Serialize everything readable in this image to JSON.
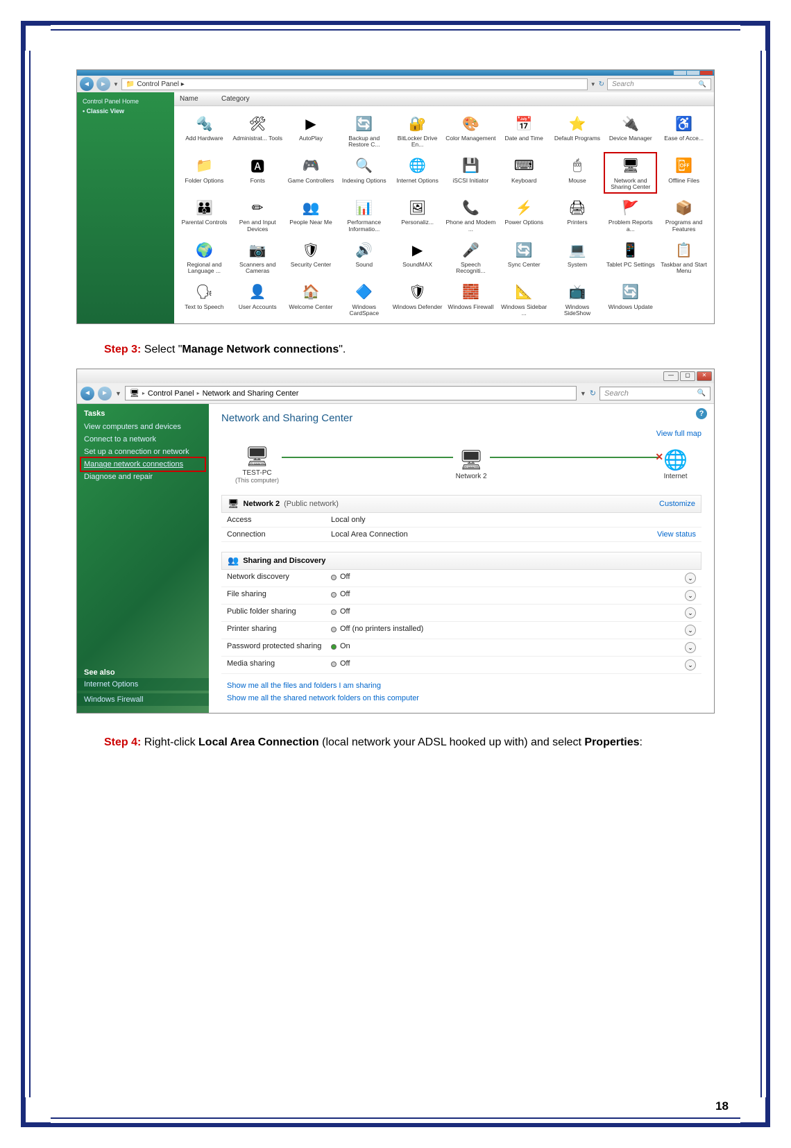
{
  "page_number": "18",
  "step3": {
    "label": "Step 3:",
    "text_before": " Select \"",
    "bold": "Manage Network connections",
    "text_after": "\"."
  },
  "step4": {
    "label": "Step 4:",
    "text_before": " Right-click ",
    "bold1": "Local Area Connection",
    "text_mid": " (local network your ADSL hooked up with) and select ",
    "bold2": "Properties",
    "text_after": ":"
  },
  "scr1": {
    "breadcrumb": "Control Panel  ▸",
    "search_placeholder": "Search",
    "col_name": "Name",
    "col_category": "Category",
    "sidebar": {
      "home": "Control Panel Home",
      "classic": "Classic View"
    },
    "items": [
      {
        "icon": "🔩",
        "label": "Add Hardware"
      },
      {
        "icon": "🛠",
        "label": "Administrat... Tools"
      },
      {
        "icon": "▶",
        "label": "AutoPlay"
      },
      {
        "icon": "🔄",
        "label": "Backup and Restore C..."
      },
      {
        "icon": "🔐",
        "label": "BitLocker Drive En..."
      },
      {
        "icon": "🎨",
        "label": "Color Management"
      },
      {
        "icon": "📅",
        "label": "Date and Time"
      },
      {
        "icon": "⭐",
        "label": "Default Programs"
      },
      {
        "icon": "🔌",
        "label": "Device Manager"
      },
      {
        "icon": "♿",
        "label": "Ease of Acce..."
      },
      {
        "icon": "📁",
        "label": "Folder Options"
      },
      {
        "icon": "🅰",
        "label": "Fonts"
      },
      {
        "icon": "🎮",
        "label": "Game Controllers"
      },
      {
        "icon": "🔍",
        "label": "Indexing Options"
      },
      {
        "icon": "🌐",
        "label": "Internet Options"
      },
      {
        "icon": "💾",
        "label": "iSCSI Initiator"
      },
      {
        "icon": "⌨",
        "label": "Keyboard"
      },
      {
        "icon": "🖱",
        "label": "Mouse"
      },
      {
        "icon": "🖥",
        "label": "Network and Sharing Center",
        "highlighted": true
      },
      {
        "icon": "📴",
        "label": "Offline Files"
      },
      {
        "icon": "👪",
        "label": "Parental Controls"
      },
      {
        "icon": "✏",
        "label": "Pen and Input Devices"
      },
      {
        "icon": "👥",
        "label": "People Near Me"
      },
      {
        "icon": "📊",
        "label": "Performance Informatio..."
      },
      {
        "icon": "🖼",
        "label": "Personaliz..."
      },
      {
        "icon": "📞",
        "label": "Phone and Modem ..."
      },
      {
        "icon": "⚡",
        "label": "Power Options"
      },
      {
        "icon": "🖨",
        "label": "Printers"
      },
      {
        "icon": "🚩",
        "label": "Problem Reports a..."
      },
      {
        "icon": "📦",
        "label": "Programs and Features"
      },
      {
        "icon": "🌍",
        "label": "Regional and Language ..."
      },
      {
        "icon": "📷",
        "label": "Scanners and Cameras"
      },
      {
        "icon": "🛡",
        "label": "Security Center"
      },
      {
        "icon": "🔊",
        "label": "Sound"
      },
      {
        "icon": "▶",
        "label": "SoundMAX"
      },
      {
        "icon": "🎤",
        "label": "Speech Recogniti..."
      },
      {
        "icon": "🔄",
        "label": "Sync Center"
      },
      {
        "icon": "💻",
        "label": "System"
      },
      {
        "icon": "📱",
        "label": "Tablet PC Settings"
      },
      {
        "icon": "📋",
        "label": "Taskbar and Start Menu"
      },
      {
        "icon": "🗣",
        "label": "Text to Speech"
      },
      {
        "icon": "👤",
        "label": "User Accounts"
      },
      {
        "icon": "🏠",
        "label": "Welcome Center"
      },
      {
        "icon": "🔷",
        "label": "Windows CardSpace"
      },
      {
        "icon": "🛡",
        "label": "Windows Defender"
      },
      {
        "icon": "🧱",
        "label": "Windows Firewall"
      },
      {
        "icon": "📐",
        "label": "Windows Sidebar ..."
      },
      {
        "icon": "📺",
        "label": "Windows SideShow"
      },
      {
        "icon": "🔄",
        "label": "Windows Update"
      }
    ]
  },
  "scr2": {
    "breadcrumb1": "Control Panel",
    "breadcrumb2": "Network and Sharing Center",
    "search_placeholder": "Search",
    "sidebar": {
      "tasks": "Tasks",
      "items": [
        "View computers and devices",
        "Connect to a network",
        "Set up a connection or network",
        "Manage network connections",
        "Diagnose and repair"
      ],
      "seealso": "See also",
      "seealso_items": [
        "Internet Options",
        "Windows Firewall"
      ]
    },
    "title": "Network and Sharing Center",
    "viewmap": "View full map",
    "nodes": {
      "pc": "TEST-PC",
      "pc_sub": "(This computer)",
      "net": "Network  2",
      "inet": "Internet"
    },
    "net_section": {
      "icon_title": "Network  2",
      "paren": "(Public network)",
      "customize": "Customize"
    },
    "rows": {
      "access_k": "Access",
      "access_v": "Local only",
      "conn_k": "Connection",
      "conn_v": "Local Area Connection",
      "conn_link": "View status"
    },
    "sharing_hdr": "Sharing and Discovery",
    "sharing": [
      {
        "k": "Network discovery",
        "v": "Off",
        "on": false
      },
      {
        "k": "File sharing",
        "v": "Off",
        "on": false
      },
      {
        "k": "Public folder sharing",
        "v": "Off",
        "on": false
      },
      {
        "k": "Printer sharing",
        "v": "Off (no printers installed)",
        "on": false
      },
      {
        "k": "Password protected sharing",
        "v": "On",
        "on": true
      },
      {
        "k": "Media sharing",
        "v": "Off",
        "on": false
      }
    ],
    "showme1": "Show me all the files and folders I am sharing",
    "showme2": "Show me all the shared network folders on this computer"
  }
}
